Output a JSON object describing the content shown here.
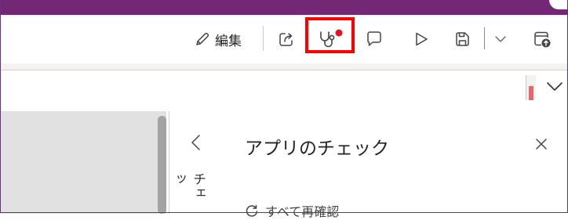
{
  "toolbar": {
    "edit_label": "編集",
    "icons": {
      "edit": "pencil-icon",
      "share": "share-icon",
      "app_checker": "stethoscope-icon",
      "comments": "comment-icon",
      "preview": "play-icon",
      "save": "save-icon",
      "save_options": "chevron-down-icon",
      "publish": "publish-icon"
    },
    "notification_dot_color": "#e81123"
  },
  "highlight_color": "#ff0000",
  "formula_bar": {
    "value": "",
    "expand_icon": "chevron-down-icon"
  },
  "collapsed_panel": {
    "label": "チェッ",
    "collapse_icon": "chevron-left-icon"
  },
  "panel": {
    "title": "アプリのチェック",
    "close_icon": "close-icon",
    "recheck_label": "すべて再確認"
  },
  "colors": {
    "title_bar": "#742774",
    "canvas": "#e1e1e1",
    "icon": "#444444"
  }
}
